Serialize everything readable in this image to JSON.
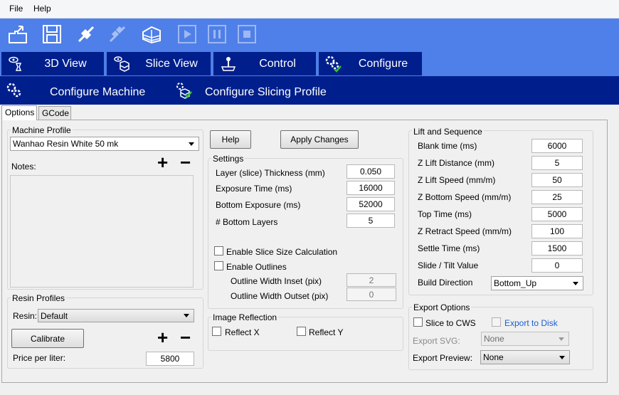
{
  "menu": {
    "file": "File",
    "help": "Help"
  },
  "toolbar": {
    "icons": [
      "open-icon",
      "save-icon",
      "connect-icon",
      "disconnect-icon",
      "slice-icon",
      "play-icon",
      "pause-icon",
      "stop-icon"
    ]
  },
  "main_tabs": [
    {
      "label": "3D View",
      "icon": "eye-view-icon"
    },
    {
      "label": "Slice View",
      "icon": "slice-view-icon"
    },
    {
      "label": "Control",
      "icon": "joystick-icon"
    },
    {
      "label": "Configure",
      "icon": "configure-gears-icon"
    }
  ],
  "sub_tabs": {
    "machine": "Configure Machine",
    "slicing": "Configure Slicing Profile"
  },
  "inner_tabs": {
    "options": "Options",
    "gcode": "GCode"
  },
  "machine_profile": {
    "title": "Machine Profile",
    "selected": "Wanhao Resin White 50 mk",
    "notes_label": "Notes:",
    "plus": "+",
    "minus": "−"
  },
  "resin_profiles": {
    "title": "Resin Profiles",
    "resin_label": "Resin:",
    "resin_selected": "Default",
    "calibrate": "Calibrate",
    "plus": "+",
    "minus": "−",
    "price_label": "Price per liter:",
    "price_value": "5800"
  },
  "actions": {
    "help": "Help",
    "apply": "Apply Changes"
  },
  "settings": {
    "title": "Settings",
    "rows": [
      {
        "label": "Layer (slice) Thickness (mm)",
        "value": "0.050"
      },
      {
        "label": "Exposure Time (ms)",
        "value": "16000"
      },
      {
        "label": "Bottom Exposure (ms)",
        "value": "52000"
      },
      {
        "label": "# Bottom Layers",
        "value": "5"
      }
    ],
    "enable_slice_size": "Enable Slice Size Calculation",
    "enable_outlines": "Enable Outlines",
    "outline_inset_label": "Outline Width Inset (pix)",
    "outline_inset_value": "2",
    "outline_outset_label": "Outline Width Outset (pix)",
    "outline_outset_value": "0"
  },
  "image_reflection": {
    "title": "Image Reflection",
    "reflect_x": "Reflect X",
    "reflect_y": "Reflect Y"
  },
  "lift": {
    "title": "Lift and Sequence",
    "rows": [
      {
        "label": "Blank time (ms)",
        "value": "6000"
      },
      {
        "label": "Z Lift Distance (mm)",
        "value": "5"
      },
      {
        "label": "Z Lift Speed (mm/m)",
        "value": "50"
      },
      {
        "label": "Z Bottom Speed (mm/m)",
        "value": "25"
      },
      {
        "label": "Top Time (ms)",
        "value": "5000"
      },
      {
        "label": "Z Retract Speed (mm/m)",
        "value": "100"
      },
      {
        "label": "Settle Time (ms)",
        "value": "1500"
      },
      {
        "label": "Slide / Tilt Value",
        "value": "0"
      }
    ],
    "build_direction_label": "Build Direction",
    "build_direction_value": "Bottom_Up"
  },
  "export": {
    "title": "Export Options",
    "slice_to_cws": "Slice to CWS",
    "export_to_disk": "Export to Disk",
    "export_svg_label": "Export SVG:",
    "export_svg_value": "None",
    "export_preview_label": "Export Preview:",
    "export_preview_value": "None"
  },
  "colors": {
    "toolbar_blue": "#4f7fe8",
    "dark_blue": "#001f8c"
  }
}
